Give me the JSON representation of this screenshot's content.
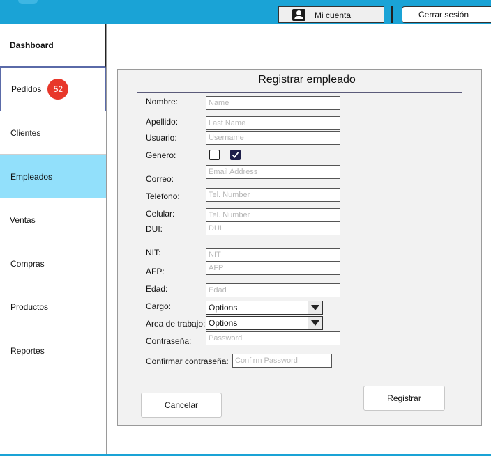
{
  "header": {
    "account_label": "Mi cuenta",
    "logout_label": "Cerrar sesión"
  },
  "sidebar": {
    "items": [
      {
        "label": "Dashboard"
      },
      {
        "label": "Pedidos",
        "badge": "52"
      },
      {
        "label": "Clientes"
      },
      {
        "label": "Empleados"
      },
      {
        "label": "Ventas"
      },
      {
        "label": "Compras"
      },
      {
        "label": "Productos"
      },
      {
        "label": "Reportes"
      }
    ]
  },
  "form": {
    "title": "Registrar empleado",
    "fields": {
      "nombre": {
        "label": "Nombre:",
        "placeholder": "Name"
      },
      "apellido": {
        "label": "Apellido:",
        "placeholder": "Last Name"
      },
      "usuario": {
        "label": "Usuario:",
        "placeholder": "Username"
      },
      "genero": {
        "label": "Genero:"
      },
      "correo": {
        "label": "Correo:",
        "placeholder": "Email Address"
      },
      "telefono": {
        "label": "Telefono:",
        "placeholder": "Tel. Number"
      },
      "celular": {
        "label": "Celular:",
        "placeholder": "Tel. Number"
      },
      "dui": {
        "label": "DUI:",
        "placeholder": "DUI"
      },
      "nit": {
        "label": "NIT:",
        "placeholder": "NIT"
      },
      "afp": {
        "label": "AFP:",
        "placeholder": "AFP"
      },
      "edad": {
        "label": "Edad:",
        "placeholder": "Edad"
      },
      "cargo": {
        "label": "Cargo:",
        "value": "Options"
      },
      "area": {
        "label": "Area de trabajo:",
        "value": "Options"
      },
      "contrasena": {
        "label": "Contraseña:",
        "placeholder": "Password"
      },
      "confirmar": {
        "label": "Confirmar contraseña:",
        "placeholder": "Confirm Password"
      }
    },
    "cancel_label": "Cancelar",
    "submit_label": "Registrar"
  }
}
